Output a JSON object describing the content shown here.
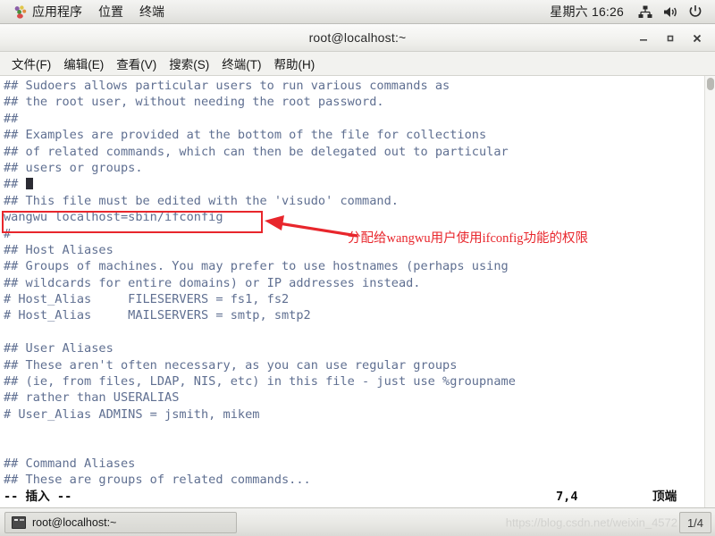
{
  "panel": {
    "logo_icon": "gnome-foot-icon",
    "menus": [
      {
        "label": "应用程序",
        "name": "applications-menu"
      },
      {
        "label": "位置",
        "name": "places-menu"
      },
      {
        "label": "终端",
        "name": "terminal-menu"
      }
    ],
    "clock": "星期六 16:26",
    "tray": [
      {
        "name": "network-icon"
      },
      {
        "name": "volume-icon"
      },
      {
        "name": "power-icon"
      }
    ]
  },
  "window": {
    "title": "root@localhost:~",
    "buttons": {
      "minimize": "minimize-button",
      "maximize": "maximize-button",
      "close": "close-button"
    },
    "menubar": [
      {
        "label": "文件(F)",
        "name": "menu-file"
      },
      {
        "label": "编辑(E)",
        "name": "menu-edit"
      },
      {
        "label": "查看(V)",
        "name": "menu-view"
      },
      {
        "label": "搜索(S)",
        "name": "menu-search"
      },
      {
        "label": "终端(T)",
        "name": "menu-terminal"
      },
      {
        "label": "帮助(H)",
        "name": "menu-help"
      }
    ]
  },
  "terminal": {
    "lines": [
      "## Sudoers allows particular users to run various commands as",
      "## the root user, without needing the root password.",
      "##",
      "## Examples are provided at the bottom of the file for collections",
      "## of related commands, which can then be delegated out to particular",
      "## users or groups.",
      "##",
      "## This file must be edited with the 'visudo' command.",
      "wangwu localhost=sbin/ifconfig",
      "#",
      "## Host Aliases",
      "## Groups of machines. You may prefer to use hostnames (perhaps using",
      "## wildcards for entire domains) or IP addresses instead.",
      "# Host_Alias     FILESERVERS = fs1, fs2",
      "# Host_Alias     MAILSERVERS = smtp, smtp2",
      "",
      "## User Aliases",
      "## These aren't often necessary, as you can use regular groups",
      "## (ie, from files, LDAP, NIS, etc) in this file - just use %groupname",
      "## rather than USERALIAS",
      "# User_Alias ADMINS = jsmith, mikem",
      "",
      "",
      "## Command Aliases",
      "## These are groups of related commands..."
    ],
    "cursor_line_index": 6,
    "cursor_prefix": "## ",
    "status": {
      "mode": "-- 插入 --",
      "position": "7,4",
      "scroll": "顶端"
    },
    "colors": {
      "comment_text": "#5f6f91",
      "status_text": "#111111",
      "background": "#ffffff"
    }
  },
  "annotation": {
    "highlight_target": "wangwu localhost=sbin/ifconfig",
    "note": "分配给wangwu用户使用ifconfig功能的权限",
    "color": "#e8262c"
  },
  "taskbar": {
    "window_button": "root@localhost:~",
    "watermark": "https://blog.csdn.net/weixin_4572",
    "workspace": "1/4"
  }
}
